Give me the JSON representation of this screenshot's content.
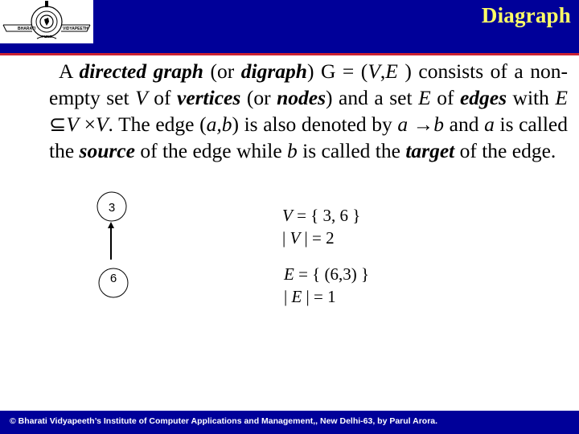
{
  "header": {
    "title": "Diagraph",
    "logo": {
      "icon": "institution-logo",
      "left_text": "BHARATI",
      "right_text": "VIDYAPEETH",
      "bottom_text": "PUNE"
    }
  },
  "body": {
    "segments": [
      {
        "text": "A ",
        "style": "normal"
      },
      {
        "text": "directed graph",
        "style": "bold-italic"
      },
      {
        "text": " (or ",
        "style": "normal"
      },
      {
        "text": "digraph",
        "style": "bold-italic"
      },
      {
        "text": ") G = (",
        "style": "normal"
      },
      {
        "text": "V",
        "style": "italic"
      },
      {
        "text": ",",
        "style": "normal"
      },
      {
        "text": "E",
        "style": "italic"
      },
      {
        "text": " ) consists of a non-empty set ",
        "style": "normal"
      },
      {
        "text": "V",
        "style": "italic"
      },
      {
        "text": " of ",
        "style": "normal"
      },
      {
        "text": "vertices",
        "style": "bold-italic"
      },
      {
        "text": " (or ",
        "style": "normal"
      },
      {
        "text": "nodes",
        "style": "bold-italic"
      },
      {
        "text": ") and a set ",
        "style": "normal"
      },
      {
        "text": "E",
        "style": "italic"
      },
      {
        "text": " of ",
        "style": "normal"
      },
      {
        "text": "edges",
        "style": "bold-italic"
      },
      {
        "text": " with ",
        "style": "normal"
      },
      {
        "text": "E",
        "style": "italic"
      },
      {
        "text": " ⊆",
        "style": "normal"
      },
      {
        "text": "V",
        "style": "italic"
      },
      {
        "text": " ×",
        "style": "normal"
      },
      {
        "text": "V",
        "style": "italic"
      },
      {
        "text": ". The edge (",
        "style": "normal"
      },
      {
        "text": "a,b",
        "style": "italic"
      },
      {
        "text": ") is also denoted by ",
        "style": "normal"
      },
      {
        "text": "a",
        "style": "italic"
      },
      {
        "text": " →",
        "style": "normal"
      },
      {
        "text": "b",
        "style": "italic"
      },
      {
        "text": " and ",
        "style": "normal"
      },
      {
        "text": "a",
        "style": "italic"
      },
      {
        "text": " is called the ",
        "style": "normal"
      },
      {
        "text": "source",
        "style": "bold-italic"
      },
      {
        "text": " of the edge while ",
        "style": "normal"
      },
      {
        "text": "b",
        "style": "italic"
      },
      {
        "text": " is called the ",
        "style": "normal"
      },
      {
        "text": "target",
        "style": "bold-italic"
      },
      {
        "text": "  of the edge.",
        "style": "normal"
      }
    ]
  },
  "graph": {
    "nodes": [
      {
        "label": "3"
      },
      {
        "label": "6"
      }
    ],
    "edges": [
      {
        "from": "6",
        "to": "3"
      }
    ]
  },
  "sets": {
    "vertex_set": {
      "lhs": "V",
      "rhs": " = { 3, 6 }"
    },
    "vertex_count": {
      "pre": "| ",
      "var": "V",
      "post": " | = 2"
    },
    "edge_set": {
      "lhs": "E",
      "rhs": " = { (6,3) }"
    },
    "edge_count": {
      "pre": "| ",
      "var": "E",
      "post": " | = 1"
    }
  },
  "footer": {
    "text": "© Bharati Vidyapeeth’s Institute of Computer Applications and Management,, New Delhi-63, by Parul Arora."
  }
}
